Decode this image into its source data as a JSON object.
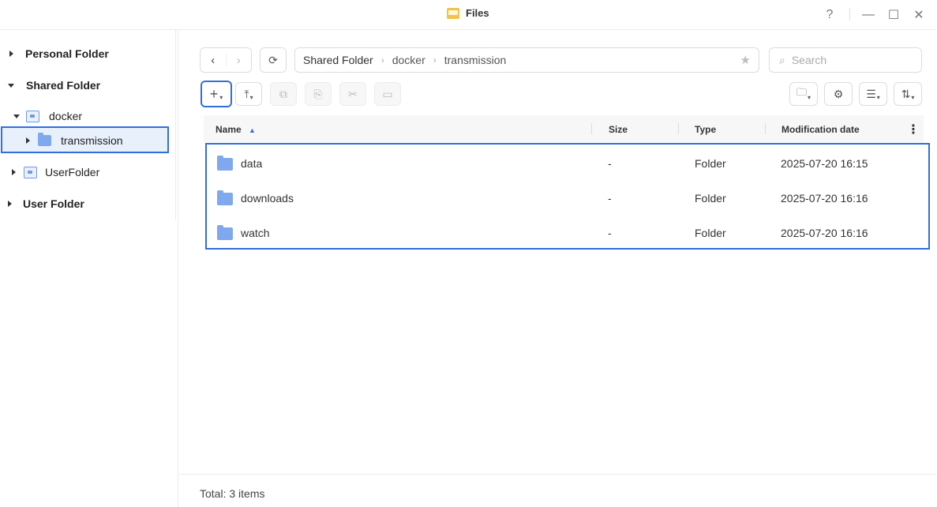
{
  "window": {
    "title": "Files",
    "help_icon": "?",
    "minimize_icon": "—",
    "maximize_icon": "☐",
    "close_icon": "✕"
  },
  "sidebar": {
    "personal_folder": "Personal Folder",
    "shared_folder": "Shared Folder",
    "docker": "docker",
    "transmission": "transmission",
    "user_folder_share": "UserFolder",
    "user_folder": "User Folder"
  },
  "toolbar": {
    "back_icon": "‹",
    "forward_icon": "›",
    "refresh_icon": "⟳",
    "create_icon": "+",
    "upload_icon": "⤒",
    "copy_icon": "⧉",
    "paste_icon": "⎘",
    "cut_icon": "✂",
    "rename_icon": "▭",
    "tools_icon": "🗀",
    "settings_icon": "⚙",
    "view_icon": "☰",
    "sort_icon": "⇅"
  },
  "breadcrumb": [
    "Shared Folder",
    "docker",
    "transmission"
  ],
  "search": {
    "placeholder": "Search"
  },
  "table": {
    "headers": {
      "name": "Name",
      "size": "Size",
      "type": "Type",
      "modified": "Modification date"
    },
    "sort_indicator": "▲",
    "more_icon": "⋮",
    "rows": [
      {
        "name": "data",
        "size": "-",
        "type": "Folder",
        "modified": "2025-07-20 16:15"
      },
      {
        "name": "downloads",
        "size": "-",
        "type": "Folder",
        "modified": "2025-07-20 16:16"
      },
      {
        "name": "watch",
        "size": "-",
        "type": "Folder",
        "modified": "2025-07-20 16:16"
      }
    ]
  },
  "footer": {
    "total": "Total: 3 items"
  },
  "colors": {
    "accent": "#2f6fdb",
    "folder": "#7fa8ef",
    "selected_bg": "#e8f0fc"
  }
}
